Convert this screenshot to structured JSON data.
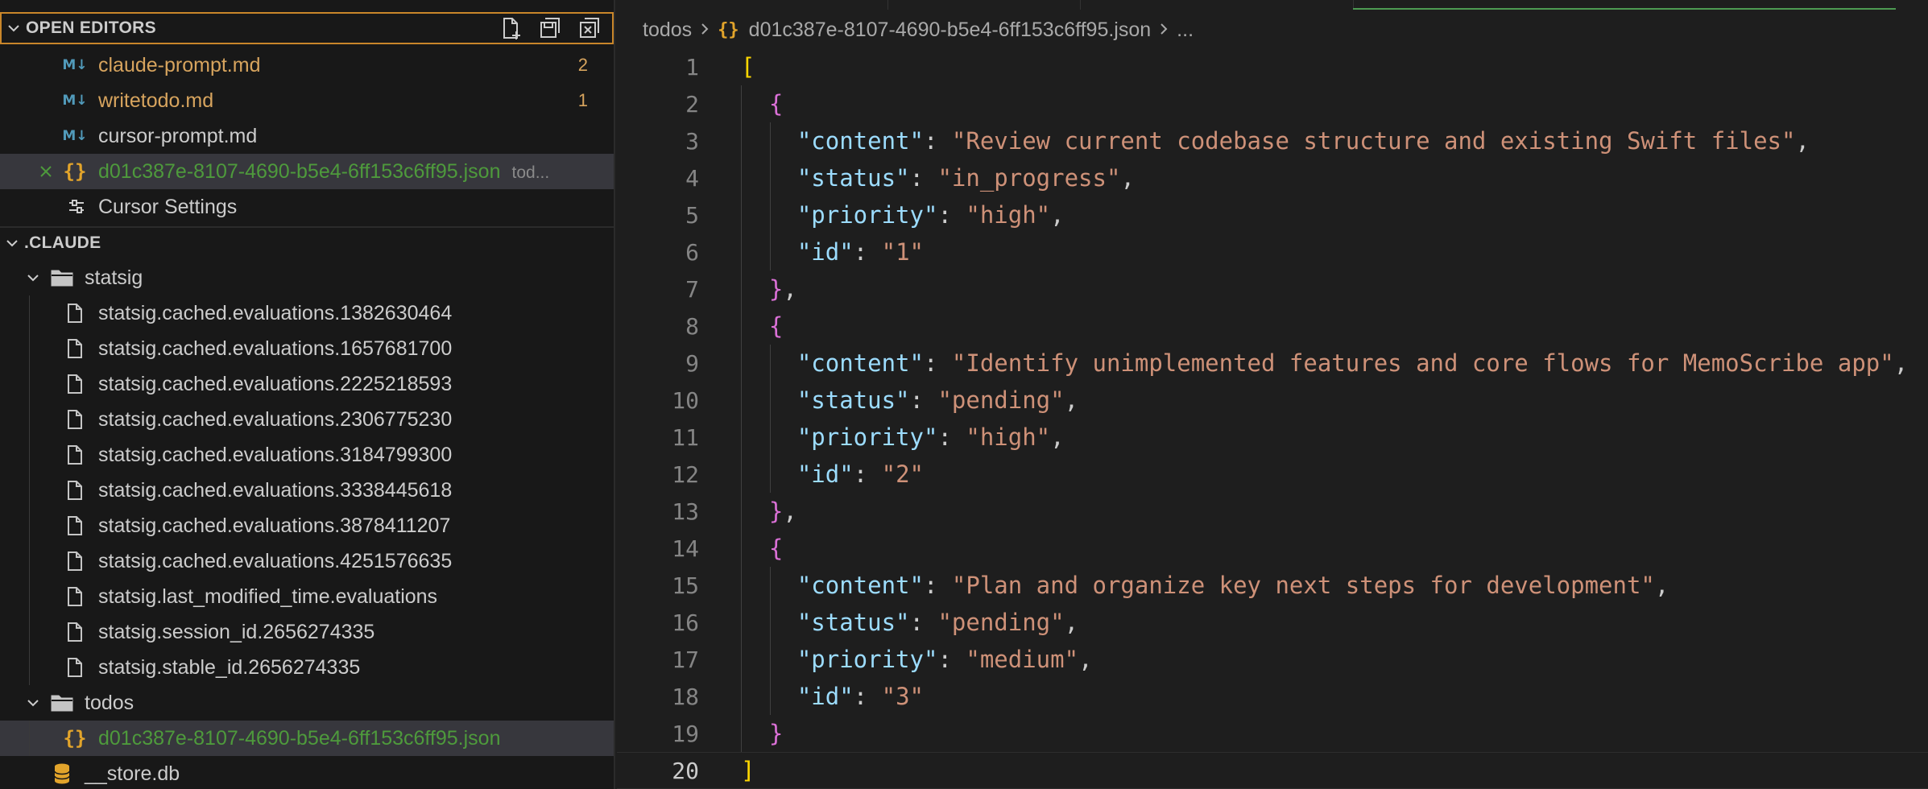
{
  "sidebar": {
    "open_editors": {
      "title": "OPEN EDITORS",
      "actions": [
        "new-file-icon",
        "save-all-icon",
        "close-all-icon"
      ],
      "items": [
        {
          "name": "claude-prompt.md",
          "icon": "markdown-icon",
          "badge": "2"
        },
        {
          "name": "writetodo.md",
          "icon": "markdown-icon",
          "badge": "1"
        },
        {
          "name": "cursor-prompt.md",
          "icon": "markdown-icon"
        },
        {
          "name": "d01c387e-8107-4690-b5e4-6ff153c6ff95.json",
          "icon": "json-icon",
          "description": "tod..."
        },
        {
          "name": "Cursor Settings",
          "icon": "settings-icon"
        }
      ]
    },
    "explorer": {
      "title": ".CLAUDE",
      "statsig_folder": "statsig",
      "statsig_files": [
        "statsig.cached.evaluations.1382630464",
        "statsig.cached.evaluations.1657681700",
        "statsig.cached.evaluations.2225218593",
        "statsig.cached.evaluations.2306775230",
        "statsig.cached.evaluations.3184799300",
        "statsig.cached.evaluations.3338445618",
        "statsig.cached.evaluations.3878411207",
        "statsig.cached.evaluations.4251576635",
        "statsig.last_modified_time.evaluations",
        "statsig.session_id.2656274335",
        "statsig.stable_id.2656274335"
      ],
      "todos_folder": "todos",
      "todos_file": "d01c387e-8107-4690-b5e4-6ff153c6ff95.json",
      "store_file": "__store.db"
    }
  },
  "editor": {
    "breadcrumb": {
      "folder": "todos",
      "file": "d01c387e-8107-4690-b5e4-6ff153c6ff95.json",
      "more": "..."
    },
    "current_line": 20,
    "todos": [
      {
        "content": "Review current codebase structure and existing Swift files",
        "status": "in_progress",
        "priority": "high",
        "id": "1"
      },
      {
        "content": "Identify unimplemented features and core flows for MemoScribe app",
        "status": "pending",
        "priority": "high",
        "id": "2"
      },
      {
        "content": "Plan and organize key next steps for development",
        "status": "pending",
        "priority": "medium",
        "id": "3"
      }
    ]
  },
  "colors": {
    "modified": "#d7a45e",
    "json_icon": "#e2a42b",
    "markdown_icon": "#519aba",
    "json_file_text": "#4e9a3c",
    "key": "#9cdcfe",
    "string": "#ce9178",
    "bracket_level1": "#ffd700",
    "bracket_level2": "#da70d6",
    "focus_border": "#c9862a"
  }
}
